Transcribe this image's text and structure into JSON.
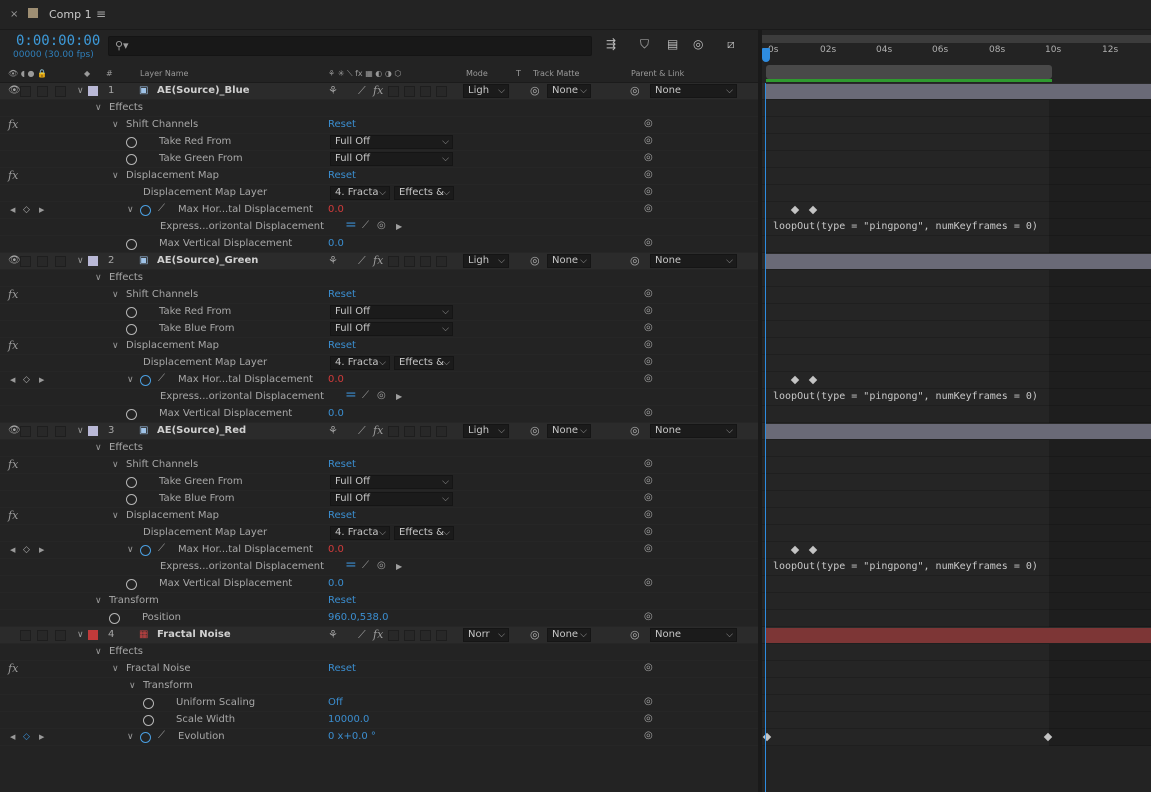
{
  "tab": {
    "close": "×",
    "title": "Comp 1",
    "menu": "≡"
  },
  "header": {
    "timecode": "0:00:00:00",
    "frames": "00000 (30.00 fps)",
    "search_placeholder": "",
    "icons": [
      "composition-mini-flowchart-icon",
      "draft-3d-icon",
      "frame-blending-icon",
      "motion-blur-icon",
      "graph-editor-icon"
    ]
  },
  "columns": {
    "layer_name": "Layer Name",
    "mode": "Mode",
    "t": "T",
    "track_matte": "Track Matte",
    "parent": "Parent & Link",
    "num": "#"
  },
  "ruler": {
    "ticks": [
      "0s",
      "02s",
      "04s",
      "06s",
      "08s",
      "10s",
      "12s"
    ]
  },
  "rows": [
    {
      "type": "layer",
      "num": "1",
      "name": "AE(Source)_Blue",
      "mode": "Ligh",
      "matte": "None",
      "parent": "None",
      "label_color": "#b9b8d6",
      "indent": 0
    },
    {
      "type": "group",
      "name": "Effects",
      "indent": 1
    },
    {
      "type": "fx",
      "name": "Shift Channels",
      "reset": "Reset",
      "indent": 2
    },
    {
      "type": "prop",
      "name": "Take Red From",
      "select": "Full Off",
      "indent": 3
    },
    {
      "type": "prop",
      "name": "Take Green From",
      "select": "Full Off",
      "indent": 3
    },
    {
      "type": "fx",
      "name": "Displacement Map",
      "reset": "Reset",
      "indent": 2
    },
    {
      "type": "prop2",
      "name": "Displacement Map Layer",
      "select": "4. Fracta",
      "select2": "Effects &",
      "indent": 3
    },
    {
      "type": "anim",
      "name": "Max Hor...tal Displacement",
      "value": "0.0",
      "indent": 3
    },
    {
      "type": "expr",
      "name": "Express...orizontal Displacement",
      "expression": "loopOut(type = \"pingpong\", numKeyframes = 0)",
      "indent": 4
    },
    {
      "type": "propv",
      "name": "Max Vertical Displacement",
      "value": "0.0",
      "indent": 3
    },
    {
      "type": "layer",
      "num": "2",
      "name": "AE(Source)_Green",
      "mode": "Ligh",
      "matte": "None",
      "parent": "None",
      "label_color": "#b9b8d6",
      "indent": 0
    },
    {
      "type": "group",
      "name": "Effects",
      "indent": 1
    },
    {
      "type": "fx",
      "name": "Shift Channels",
      "reset": "Reset",
      "indent": 2
    },
    {
      "type": "prop",
      "name": "Take Red From",
      "select": "Full Off",
      "indent": 3
    },
    {
      "type": "prop",
      "name": "Take Blue From",
      "select": "Full Off",
      "indent": 3
    },
    {
      "type": "fx",
      "name": "Displacement Map",
      "reset": "Reset",
      "indent": 2
    },
    {
      "type": "prop2",
      "name": "Displacement Map Layer",
      "select": "4. Fracta",
      "select2": "Effects &",
      "indent": 3
    },
    {
      "type": "anim",
      "name": "Max Hor...tal Displacement",
      "value": "0.0",
      "indent": 3
    },
    {
      "type": "expr",
      "name": "Express...orizontal Displacement",
      "expression": "loopOut(type = \"pingpong\", numKeyframes = 0)",
      "indent": 4
    },
    {
      "type": "propv",
      "name": "Max Vertical Displacement",
      "value": "0.0",
      "indent": 3
    },
    {
      "type": "layer",
      "num": "3",
      "name": "AE(Source)_Red",
      "mode": "Ligh",
      "matte": "None",
      "parent": "None",
      "label_color": "#b9b8d6",
      "indent": 0
    },
    {
      "type": "group",
      "name": "Effects",
      "indent": 1
    },
    {
      "type": "fx",
      "name": "Shift Channels",
      "reset": "Reset",
      "indent": 2
    },
    {
      "type": "prop",
      "name": "Take Green From",
      "select": "Full Off",
      "indent": 3
    },
    {
      "type": "prop",
      "name": "Take Blue From",
      "select": "Full Off",
      "indent": 3
    },
    {
      "type": "fx",
      "name": "Displacement Map",
      "reset": "Reset",
      "indent": 2
    },
    {
      "type": "prop2",
      "name": "Displacement Map Layer",
      "select": "4. Fracta",
      "select2": "Effects &",
      "indent": 3
    },
    {
      "type": "anim",
      "name": "Max Hor...tal Displacement",
      "value": "0.0",
      "indent": 3
    },
    {
      "type": "expr",
      "name": "Express...orizontal Displacement",
      "expression": "loopOut(type = \"pingpong\", numKeyframes = 0)",
      "indent": 4
    },
    {
      "type": "propv",
      "name": "Max Vertical Displacement",
      "value": "0.0",
      "indent": 3
    },
    {
      "type": "group",
      "name": "Transform",
      "reset": "Reset",
      "indent": 1
    },
    {
      "type": "propv",
      "name": "Position",
      "value": "960.0,538.0",
      "indent": 2
    },
    {
      "type": "layer",
      "num": "4",
      "name": "Fractal Noise",
      "mode": "Norr",
      "matte": "None",
      "parent": "None",
      "label_color": "#c03a3a",
      "indent": 0,
      "solid": true
    },
    {
      "type": "group",
      "name": "Effects",
      "indent": 1
    },
    {
      "type": "fx",
      "name": "Fractal Noise",
      "reset": "Reset",
      "indent": 2
    },
    {
      "type": "group",
      "name": "Transform",
      "indent": 3
    },
    {
      "type": "propv",
      "name": "Uniform Scaling",
      "value": "Off",
      "indent": 4
    },
    {
      "type": "propv",
      "name": "Scale Width",
      "value": "10000.0",
      "indent": 4
    },
    {
      "type": "anim",
      "name": "Evolution",
      "value": "0 x+0.0 °",
      "indent": 3,
      "evo": true
    }
  ]
}
